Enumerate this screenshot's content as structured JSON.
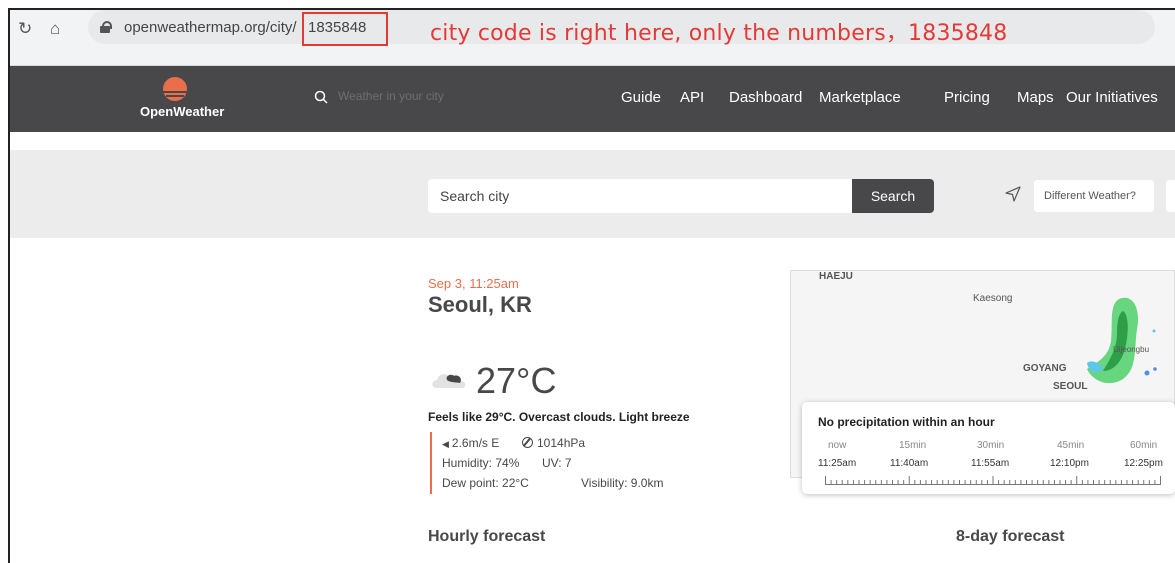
{
  "browser": {
    "reload_icon": "reload-icon",
    "home_icon": "home-icon",
    "url_domain": "openweathermap.org/city/",
    "url_code": "1835848",
    "annotation": "city code is right here, only the numbers，1835848"
  },
  "site_header": {
    "logo_text": "OpenWeather",
    "search_placeholder": "Weather in your city",
    "nav": [
      "Guide",
      "API",
      "Dashboard",
      "Marketplace",
      "Pricing",
      "Maps",
      "Our Initiatives"
    ]
  },
  "search": {
    "placeholder": "Search city",
    "button": "Search",
    "different_weather": "Different Weather?"
  },
  "current": {
    "date_time": "Sep 3, 11:25am",
    "city": "Seoul, KR",
    "temperature": "27°C",
    "summary": "Feels like 29°C. Overcast clouds. Light breeze",
    "wind": "2.6m/s E",
    "pressure": "1014hPa",
    "humidity": "Humidity: 74%",
    "uv": "UV: 7",
    "dew_point": "Dew point: 22°C",
    "visibility": "Visibility: 9.0km"
  },
  "map": {
    "labels": [
      "HAEJU",
      "Kaesong",
      "Uijeongbu",
      "GOYANG",
      "SEOUL"
    ],
    "precip_title": "No precipitation within an hour",
    "ticks": [
      "now",
      "15min",
      "30min",
      "45min",
      "60min"
    ],
    "times": [
      "11:25am",
      "11:40am",
      "11:55am",
      "12:10pm",
      "12:25pm"
    ]
  },
  "sections": {
    "hourly": "Hourly forecast",
    "daily": "8-day forecast"
  },
  "colors": {
    "accent": "#eb6e4b",
    "header": "#48484a",
    "annotation": "#e53935"
  }
}
